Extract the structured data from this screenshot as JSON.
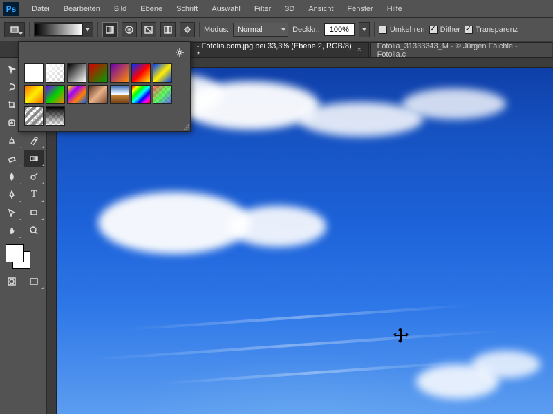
{
  "app": {
    "logo": "Ps"
  },
  "menu": [
    "Datei",
    "Bearbeiten",
    "Bild",
    "Ebene",
    "Schrift",
    "Auswahl",
    "Filter",
    "3D",
    "Ansicht",
    "Fenster",
    "Hilfe"
  ],
  "options": {
    "modus_label": "Modus:",
    "modus_value": "Normal",
    "opacity_label": "Deckkr.:",
    "opacity_value": "100%",
    "reverse_label": "Umkehren",
    "reverse_checked": false,
    "dither_label": "Dither",
    "dither_checked": true,
    "transparency_label": "Transparenz",
    "transparency_checked": true
  },
  "tabs": [
    {
      "label": "- Fotolia.com.jpg bei 33,3% (Ebene 2, RGB/8) *",
      "active": true
    },
    {
      "label": "Fotolia_31333343_M - © Jürgen Fälchle - Fotolia.c",
      "active": false
    }
  ],
  "gradient_presets": [
    {
      "name": "foreground-background",
      "css": "linear-gradient(135deg,#fff,#fff)"
    },
    {
      "name": "foreground-transparent",
      "class": "transp",
      "css": "linear-gradient(135deg,#fff,rgba(255,255,255,0))"
    },
    {
      "name": "black-white",
      "css": "linear-gradient(135deg,#000,#fff)"
    },
    {
      "name": "red-green",
      "css": "linear-gradient(135deg,#d40000,#00a000)"
    },
    {
      "name": "violet-orange",
      "css": "linear-gradient(135deg,#6a00b0,#ff8c00)"
    },
    {
      "name": "blue-red-yellow",
      "css": "linear-gradient(135deg,#0030ff 0%,#ff0000 50%,#ffee00 100%)"
    },
    {
      "name": "blue-yellow-blue",
      "css": "linear-gradient(135deg,#0040ff 0%,#ffee00 50%,#0040ff 100%)"
    },
    {
      "name": "orange-yellow-orange",
      "css": "linear-gradient(135deg,#ff6a00 0%,#ffee00 50%,#ff6a00 100%)"
    },
    {
      "name": "violet-green-orange",
      "css": "linear-gradient(135deg,#7a00ff 0%,#00d000 50%,#ff8000 100%)"
    },
    {
      "name": "yellow-violet-orange-blue",
      "css": "linear-gradient(135deg,#ffee00 0%,#a000ff 33%,#ff8000 66%,#0060ff 100%)"
    },
    {
      "name": "copper",
      "css": "linear-gradient(135deg,#5a3420 0%,#e8b088 50%,#7a4a30 100%)"
    },
    {
      "name": "chrome",
      "css": "linear-gradient(180deg,#3a6ab0 0%,#d8e8ff 40%,#ffffff 50%,#c08030 55%,#704018 100%)"
    },
    {
      "name": "spectrum",
      "css": "linear-gradient(135deg,#ff0000,#ffff00,#00ff00,#00ffff,#0000ff,#ff00ff,#ff0000)"
    },
    {
      "name": "transparent-rainbow",
      "class": "transp",
      "css": "linear-gradient(135deg,rgba(255,0,0,.6),rgba(0,255,0,.6),rgba(0,0,255,.6))"
    },
    {
      "name": "transparent-stripes",
      "class": "transp",
      "css": "repeating-linear-gradient(135deg,#888 0 4px,transparent 4px 8px)"
    },
    {
      "name": "neutral-density",
      "css": "linear-gradient(180deg,#000,rgba(0,0,0,0))",
      "class": "transp"
    }
  ],
  "tools": {
    "fg_color": "#ffffff",
    "bg_color": "#ffffff"
  }
}
